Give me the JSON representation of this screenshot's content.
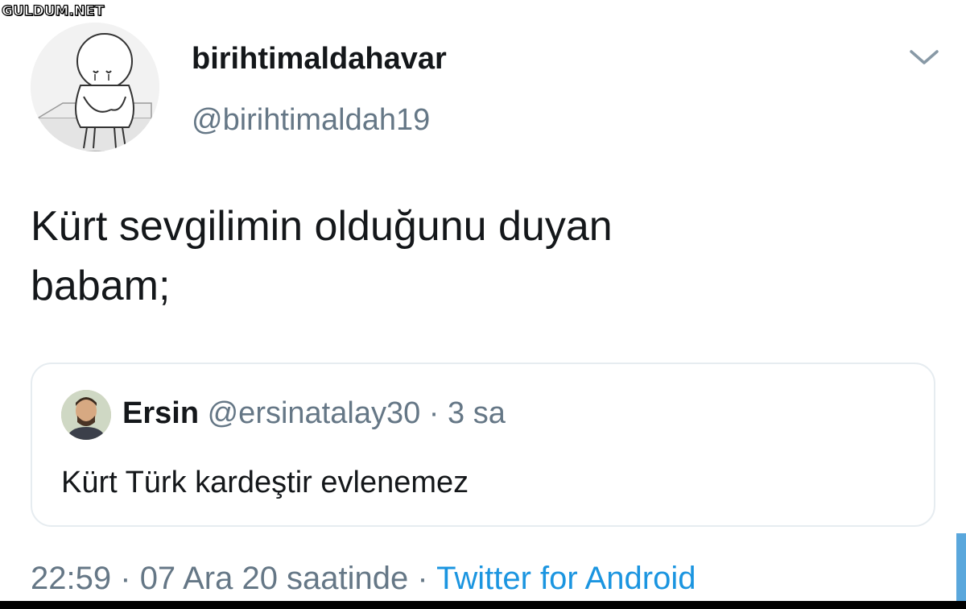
{
  "watermark": "GULDUM.NET",
  "tweet": {
    "display_name": "birihtimaldahavar",
    "handle": "@birihtimaldah19",
    "avatar_icon": "cartoon-character-avatar",
    "menu_icon": "chevron-down-icon",
    "text_line_1": "Kürt sevgilimin olduğunu duyan",
    "text_line_2": "babam;"
  },
  "quoted_tweet": {
    "name": "Ersin",
    "handle": "@ersinatalay30",
    "separator": "·",
    "time": "3 sa",
    "text": "Kürt Türk kardeştir evlenemez"
  },
  "footer": {
    "time": "22:59",
    "separator1": "·",
    "date": "07 Ara 20 saatinde",
    "separator2": "·",
    "source": "Twitter for Android"
  },
  "colors": {
    "text_primary": "#14171a",
    "text_secondary": "#657786",
    "link": "#1b95e0",
    "border": "#e6ecf0"
  }
}
